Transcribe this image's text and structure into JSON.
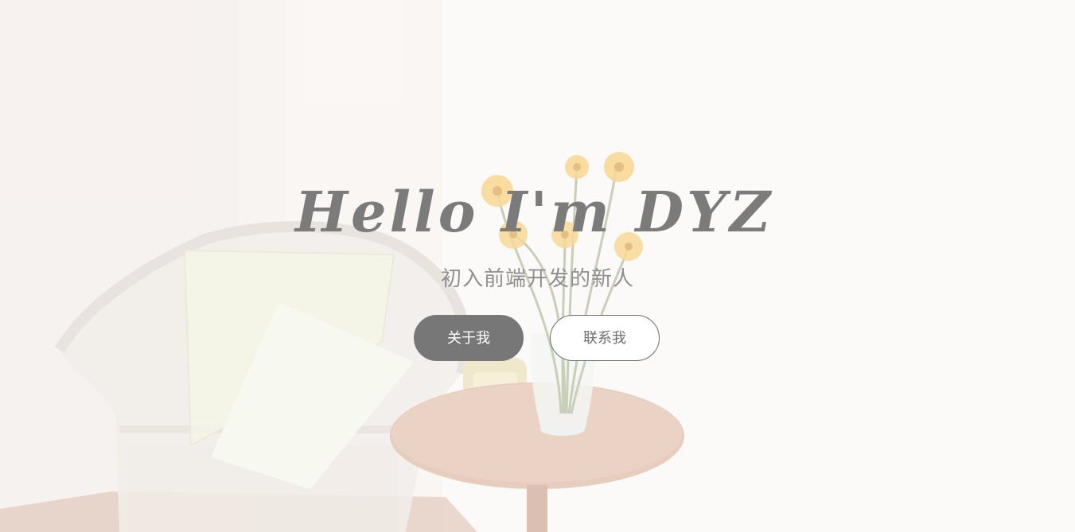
{
  "hero": {
    "title": "Hello I'm DYZ",
    "subtitle": "初入前端开发的新人",
    "buttons": {
      "about_label": "关于我",
      "contact_label": "联系我"
    },
    "background_image": "room-corner-wicker-chair-table-flowers"
  },
  "colors": {
    "title": "#7b7b7b",
    "subtitle": "#8f8f8f",
    "primary_button_bg": "#777777",
    "primary_button_text": "#ffffff",
    "secondary_button_border": "#6e6e6e",
    "background": "#f8f4f1"
  }
}
